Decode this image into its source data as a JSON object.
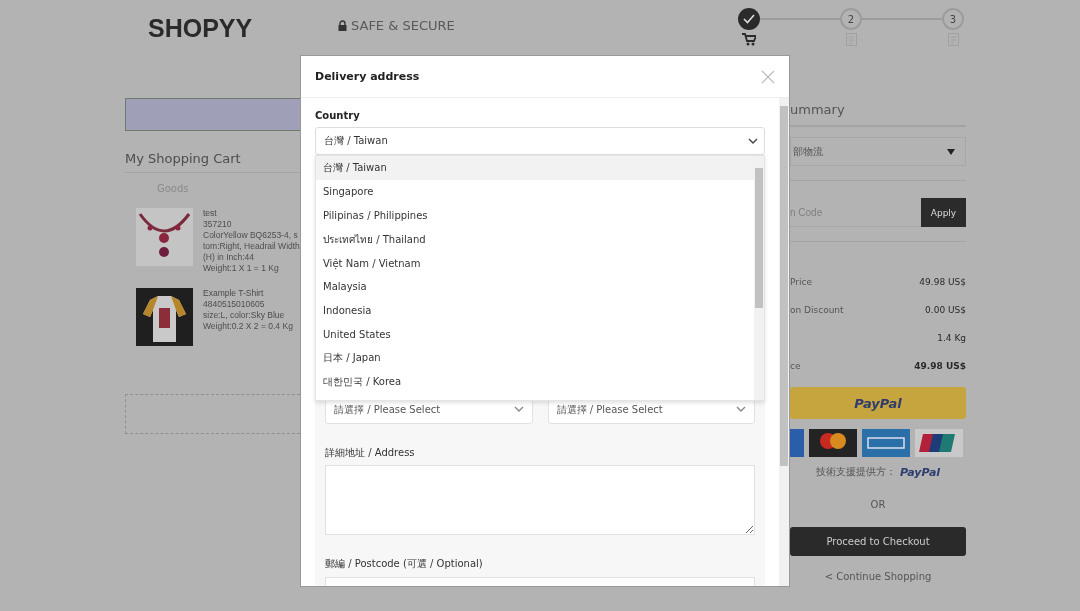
{
  "header": {
    "logo": "SHOPYY",
    "secure": "SAFE & SECURE",
    "steps": [
      {
        "done": true
      },
      {
        "number": "2",
        "done": false
      },
      {
        "number": "3",
        "done": false
      }
    ]
  },
  "cart": {
    "title": "My Shopping Cart",
    "column": "Goods",
    "items": [
      {
        "name": "test",
        "sku": "357210",
        "lines": [
          "ColorYellow BQ6253-4, s",
          "tom:Right, Headrail Width",
          "(H) in Inch:44",
          "Weight:1 X 1 = 1 Kg"
        ]
      },
      {
        "name": "Example T-Shirt",
        "sku": "4840515010605",
        "lines": [
          "size:L, color:Sky Blue",
          "Weight:0.2 X 2 = 0.4 Kg"
        ]
      }
    ]
  },
  "summary": {
    "title": "ummary",
    "shipping": "部物流",
    "coupon_placeholder": "n Code",
    "apply": "Apply",
    "rows": [
      {
        "label": "Price",
        "value": "49.98 US$",
        "bold": false
      },
      {
        "label": "on Discount",
        "value": "0.00 US$",
        "bold": false
      },
      {
        "label": "",
        "value": "1.4 Kg",
        "bold": false
      },
      {
        "label": "ce",
        "value": "49.98 US$",
        "bold": true
      }
    ],
    "paypal": "PayPal",
    "powered": "技術支援提供方：",
    "powered_brand": "PayPal",
    "or": "OR",
    "checkout": "Proceed to Checkout",
    "continue": "< Continue Shopping"
  },
  "modal": {
    "title": "Delivery address",
    "country_label": "Country",
    "country_value": "台灣 / Taiwan",
    "options": [
      {
        "label": "台灣 / Taiwan",
        "selected": true
      },
      {
        "label": "Singapore",
        "selected": false
      },
      {
        "label": "Pilipinas / Philippines",
        "selected": false
      },
      {
        "label": "ประเทศไทย / Thailand",
        "selected": false
      },
      {
        "label": "Việt Nam / Vietnam",
        "selected": false
      },
      {
        "label": "Malaysia",
        "selected": false
      },
      {
        "label": "Indonesia",
        "selected": false
      },
      {
        "label": "United States",
        "selected": false
      },
      {
        "label": "日本 / Japan",
        "selected": false
      },
      {
        "label": "대한민국 / Korea",
        "selected": false
      }
    ],
    "region_selects": [
      "請選擇 / Please Select",
      "請選擇 / Please Select"
    ],
    "address_label": "詳細地址 / Address",
    "postcode_label": "郵編 / Postcode (可選 / Optional)"
  }
}
